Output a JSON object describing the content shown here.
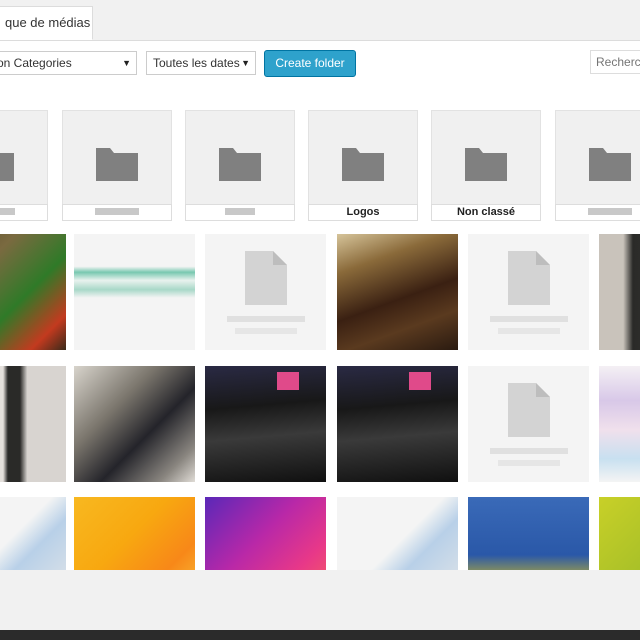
{
  "tabs": [
    {
      "label": "que de médias"
    }
  ],
  "filters": {
    "category": "on Categories",
    "dates": "Toutes les dates",
    "create_folder": "Create folder",
    "search_placeholder": "Recherch"
  },
  "folders": [
    {
      "label": ""
    },
    {
      "label": ""
    },
    {
      "label": ""
    },
    {
      "label": "Logos"
    },
    {
      "label": "Non classé"
    },
    {
      "label": ""
    }
  ],
  "colors": {
    "accent": "#2ea2cc",
    "folder_icon": "#808080"
  }
}
